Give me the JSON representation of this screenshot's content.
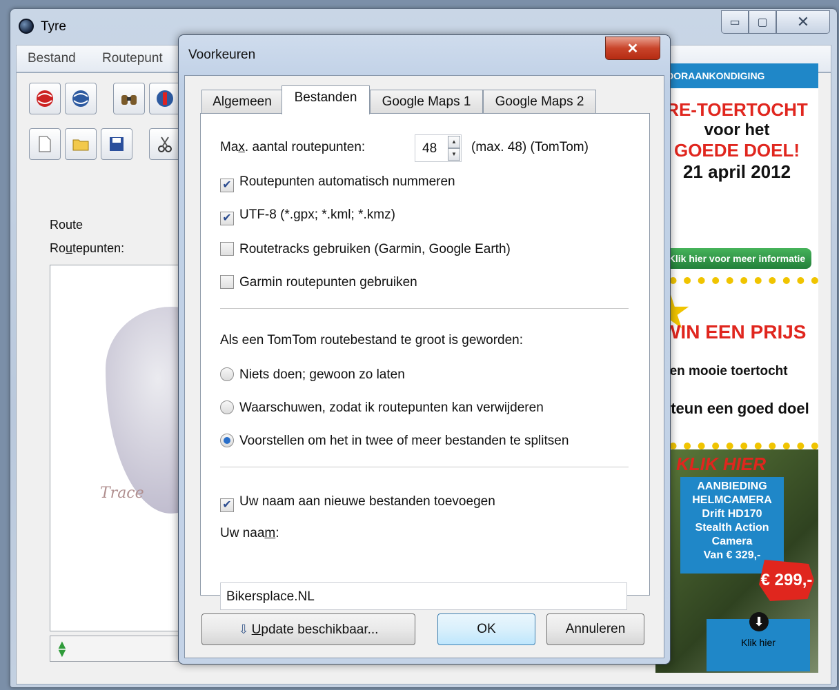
{
  "main_window": {
    "title": "Tyre",
    "controls": {
      "minimize": "▭",
      "maximize": "▢",
      "close": "✕"
    },
    "menu": [
      "Bestand",
      "Routepunt"
    ],
    "route_label": "Route",
    "points_label_pre": "Ro",
    "points_label_ul": "u",
    "points_label_post": "tepunten:",
    "logo_text": "Trace"
  },
  "ads": {
    "ad1_header": "VOORAANKONDIGING",
    "ad1_line1": "RE-TOERTOCHT",
    "ad1_line2": "voor het",
    "ad1_line3": "GOEDE DOEL!",
    "ad1_line4": "21 april 2012",
    "ad1_button": "Klik hier voor meer informatie",
    "ad2_line1": "WIN EEN PRIJS",
    "ad2_line2": "een mooie toertocht",
    "ad2_line3": "steun een goed doel",
    "ad3_klik": "KLIK HIER",
    "ad3_box": [
      "AANBIEDING",
      "HELMCAMERA",
      "Drift HD170",
      "Stealth Action",
      "Camera",
      "Van € 329,-"
    ],
    "ad3_price": "€ 299,-",
    "ad3_bottom": "Klik hier"
  },
  "dialog": {
    "title": "Voorkeuren",
    "close_glyph": "✕",
    "tabs": [
      "Algemeen",
      "Bestanden",
      "Google Maps 1",
      "Google Maps 2"
    ],
    "active_tab": "Bestanden",
    "max_points_pre": "Ma",
    "max_points_ul": "x",
    "max_points_post": ". aantal routepunten:",
    "max_points_value": "48",
    "max_points_note": "(max. 48) (TomTom)",
    "checkboxes": [
      {
        "label": "Routepunten automatisch nummeren",
        "checked": true
      },
      {
        "label": "UTF-8 (*.gpx; *.kml; *.kmz)",
        "checked": true
      },
      {
        "label": "Routetracks gebruiken (Garmin, Google Earth)",
        "checked": false
      },
      {
        "label": "Garmin routepunten gebruiken",
        "checked": false
      }
    ],
    "too_large_label": "Als een TomTom routebestand te groot is geworden:",
    "radios": [
      {
        "label": "Niets doen; gewoon zo laten",
        "selected": false
      },
      {
        "label": "Waarschuwen, zodat ik routepunten kan verwijderen",
        "selected": false
      },
      {
        "label": "Voorstellen om het in twee of meer bestanden te splitsen",
        "selected": true
      }
    ],
    "add_name": {
      "label": "Uw naam aan nieuwe bestanden toevoegen",
      "checked": true
    },
    "name_label_pre": "Uw naa",
    "name_label_ul": "m",
    "name_label_post": ":",
    "name_value": "Bikersplace.NL",
    "buttons": {
      "update_ul": "U",
      "update_rest": "pdate beschikbaar...",
      "ok": "OK",
      "cancel": "Annuleren"
    }
  },
  "colors": {
    "accent_blue": "#1f87c8",
    "ad_red": "#e0261e",
    "close_red": "#c9442a"
  }
}
